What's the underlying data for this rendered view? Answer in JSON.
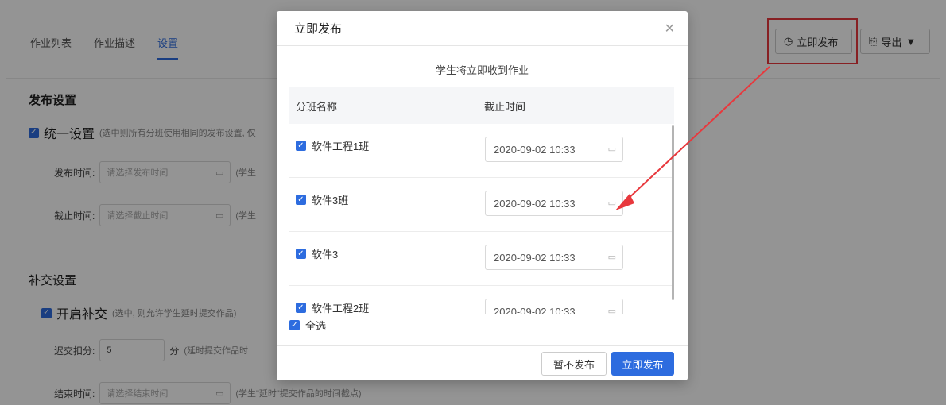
{
  "tabs": [
    {
      "label": "作业列表"
    },
    {
      "label": "作业描述"
    },
    {
      "label": "设置"
    }
  ],
  "toolbar": {
    "publish_label": "立即发布",
    "export_label": "导出"
  },
  "publish_settings": {
    "title": "发布设置",
    "unify_label": "统一设置",
    "unify_note": "(选中则所有分班使用相同的发布设置, 仅",
    "publish_time_label": "发布时间:",
    "publish_time_placeholder": "请选择发布时间",
    "publish_time_hint": "(学生",
    "deadline_label": "截止时间:",
    "deadline_placeholder": "请选择截止时间",
    "deadline_hint": "(学生"
  },
  "late_settings": {
    "title": "补交设置",
    "enable_label": "开启补交",
    "enable_note": "(选中, 则允许学生延时提交作品)",
    "penalty_label": "迟交扣分:",
    "penalty_value": "5",
    "penalty_unit": "分",
    "penalty_hint": "(延时提交作品时",
    "end_time_label": "结束时间:",
    "end_time_placeholder": "请选择结束时间",
    "end_time_hint": "(学生\"延时\"提交作品的时间截点)"
  },
  "modal": {
    "title": "立即发布",
    "subtitle": "学生将立即收到作业",
    "col_class": "分班名称",
    "col_deadline": "截止时间",
    "rows": [
      {
        "name": "软件工程1班",
        "deadline": "2020-09-02 10:33",
        "checked": true
      },
      {
        "name": "软件3班",
        "deadline": "2020-09-02 10:33",
        "checked": true
      },
      {
        "name": "软件3",
        "deadline": "2020-09-02 10:33",
        "checked": true
      },
      {
        "name": "软件工程2班",
        "deadline": "2020-09-02 10:33",
        "checked": true
      }
    ],
    "select_all": "全选",
    "cancel_label": "暂不发布",
    "confirm_label": "立即发布"
  },
  "colors": {
    "accent": "#2d6cdf",
    "highlight": "#e8383d"
  }
}
